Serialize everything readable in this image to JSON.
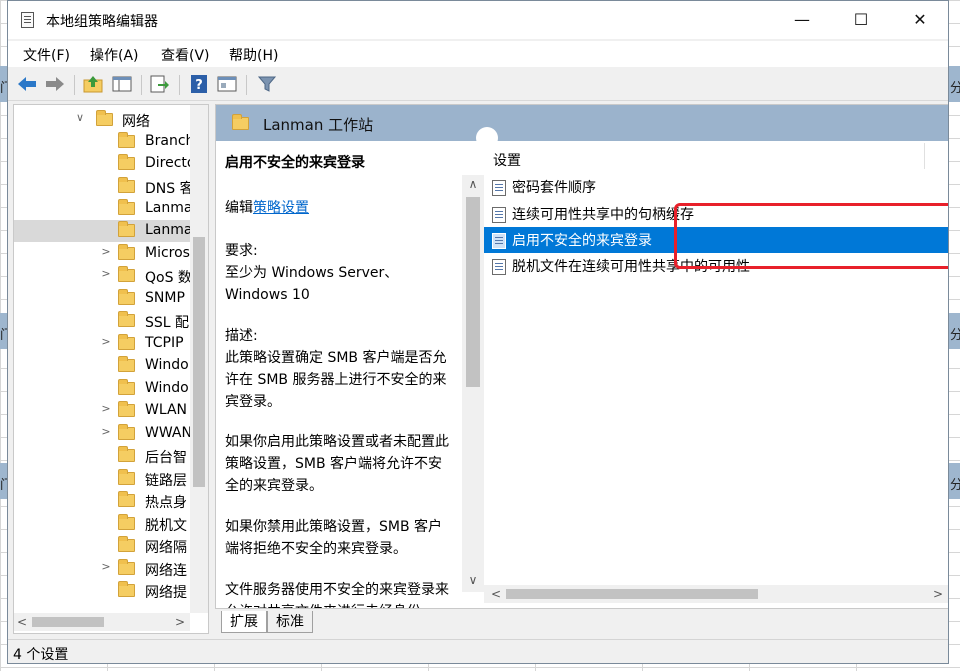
{
  "window": {
    "title": "本地组策略编辑器",
    "controls": {
      "minimize": "—",
      "maximize": "☐",
      "close": "✕"
    }
  },
  "menu": [
    "文件(F)",
    "操作(A)",
    "查看(V)",
    "帮助(H)"
  ],
  "toolbar": [
    "back-icon",
    "forward-icon",
    "up-folder-icon",
    "show-hide-tree-icon",
    "export-list-icon",
    "help-icon",
    "properties-icon",
    "filter-icon"
  ],
  "tree": {
    "items": [
      {
        "label": "网络",
        "expander": "∨"
      },
      {
        "label": "Branch",
        "expander": ""
      },
      {
        "label": "Directo",
        "expander": ""
      },
      {
        "label": "DNS 客",
        "expander": ""
      },
      {
        "label": "Lanma",
        "expander": ""
      },
      {
        "label": "Lanma",
        "expander": ""
      },
      {
        "label": "Micros",
        "expander": ">"
      },
      {
        "label": "QoS 数",
        "expander": ">"
      },
      {
        "label": "SNMP",
        "expander": ""
      },
      {
        "label": "SSL 配",
        "expander": ""
      },
      {
        "label": "TCPIP",
        "expander": ">"
      },
      {
        "label": "Windo",
        "expander": ""
      },
      {
        "label": "Windo",
        "expander": ""
      },
      {
        "label": "WLAN",
        "expander": ">"
      },
      {
        "label": "WWAN",
        "expander": ">"
      },
      {
        "label": "后台智",
        "expander": ""
      },
      {
        "label": "链路层",
        "expander": ""
      },
      {
        "label": "热点身",
        "expander": ""
      },
      {
        "label": "脱机文",
        "expander": ""
      },
      {
        "label": "网络隔",
        "expander": ""
      },
      {
        "label": "网络连",
        "expander": ">"
      },
      {
        "label": "网络提",
        "expander": ""
      }
    ],
    "selected_index": 5
  },
  "content": {
    "header": "Lanman 工作站",
    "description": {
      "title": "启用不安全的来宾登录",
      "edit_prefix": "编辑",
      "edit_link": "策略设置",
      "requirements_label": "要求:",
      "requirements_text": "至少为 Windows Server、Windows 10",
      "description_label": "描述:",
      "paragraph1": "此策略设置确定 SMB 客户端是否允许在 SMB 服务器上进行不安全的来宾登录。",
      "paragraph2": "如果你启用此策略设置或者未配置此策略设置，SMB 客户端将允许不安全的来宾登录。",
      "paragraph3": "如果你禁用此策略设置，SMB 客户端将拒绝不安全的来宾登录。",
      "paragraph4": "文件服务器使用不安全的来宾登录来允许对共享文件夹进行未经身份"
    },
    "list": {
      "header": "设置",
      "rows": [
        "密码套件顺序",
        "连续可用性共享中的句柄缓存",
        "启用不安全的来宾登录",
        "脱机文件在连续可用性共享中的可用性"
      ],
      "selected_index": 2
    },
    "tabs": [
      "扩展",
      "标准"
    ],
    "active_tab": 0
  },
  "status": "4 个设置",
  "background": {
    "left_glyph": "门",
    "right_glyph": "分"
  },
  "colors": {
    "selection": "#0078d7",
    "header_band": "#9bb3cc",
    "highlight_box": "#e8202a",
    "link": "#0066cc"
  }
}
